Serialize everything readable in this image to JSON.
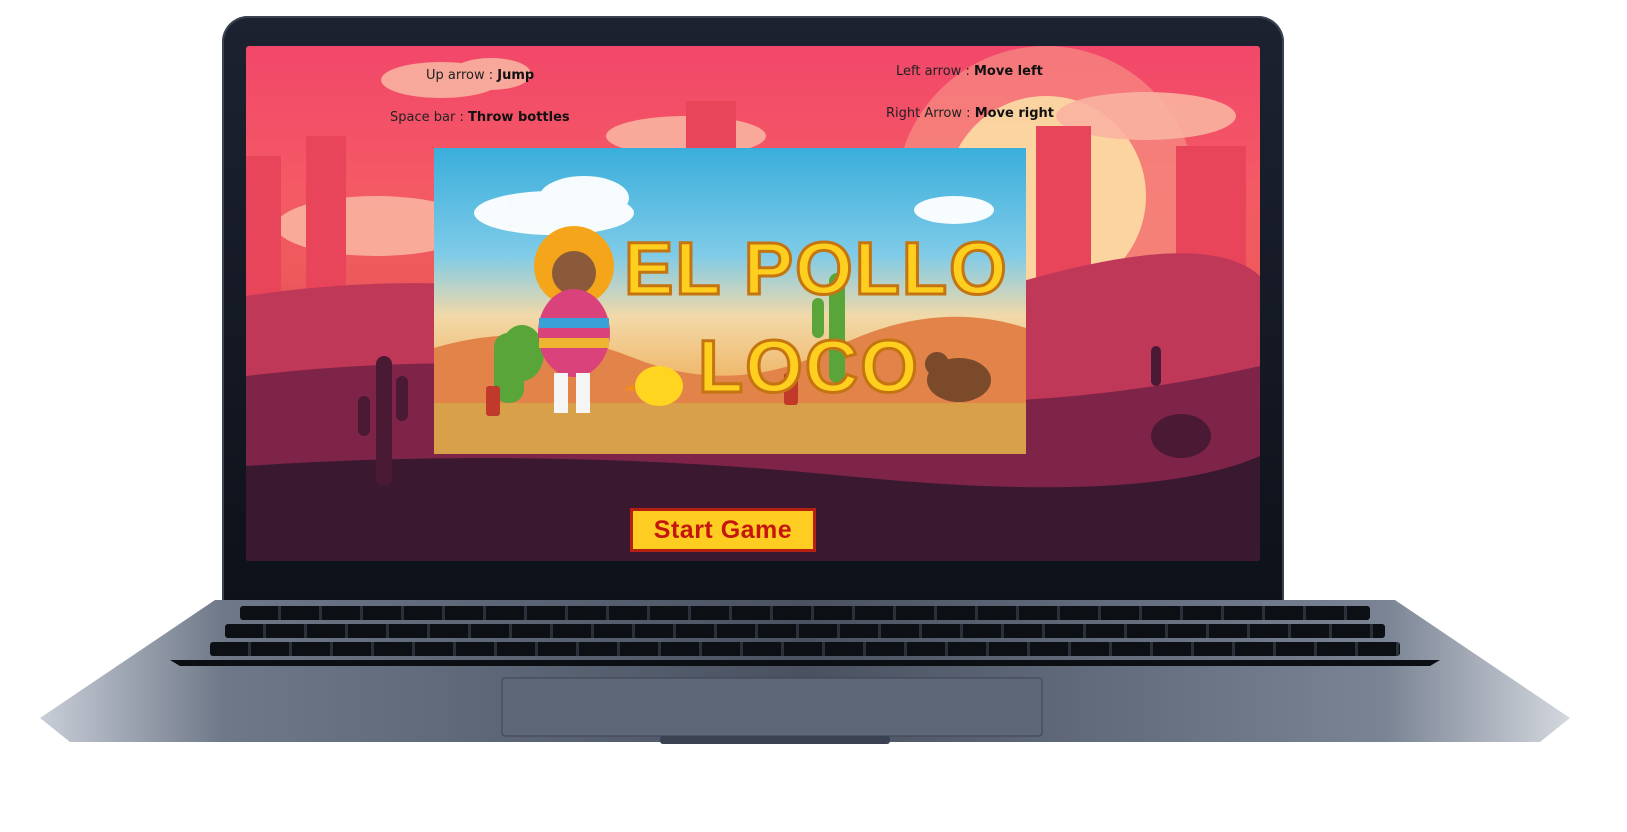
{
  "controls": {
    "up": {
      "key": "Up arrow :",
      "action": "Jump"
    },
    "space": {
      "key": "Space bar :",
      "action": "Throw bottles"
    },
    "left": {
      "key": "Left arrow :",
      "action": "Move left"
    },
    "right": {
      "key": "Right Arrow :",
      "action": "Move right"
    }
  },
  "title_card": {
    "line1": "EL POLLO",
    "line2": "LOCO"
  },
  "start_button": {
    "label": "Start Game"
  },
  "colors": {
    "sky": "#f2476a",
    "button_bg": "#ffcc22",
    "button_text": "#c4160e",
    "logo": "#ffcf1f"
  }
}
